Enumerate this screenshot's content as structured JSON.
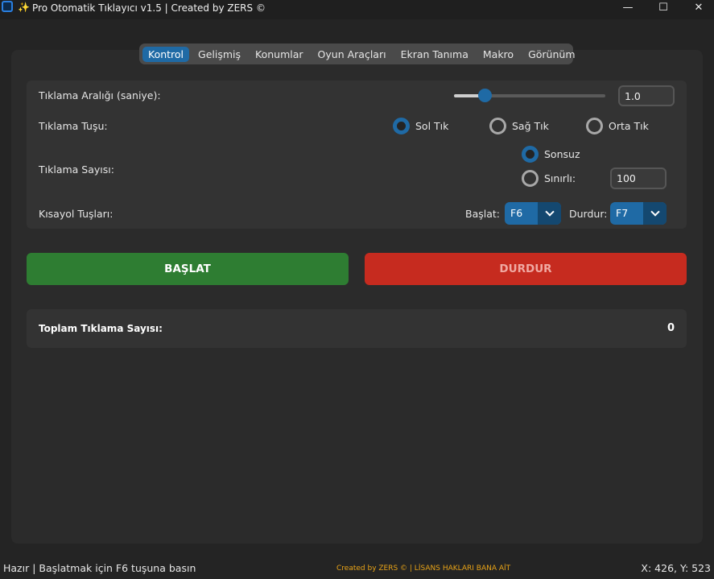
{
  "window": {
    "title": "Pro Otomatik Tıklayıcı v1.5 | Created by ZERS ©",
    "sparkle_glyph": "✨",
    "minimize_glyph": "—",
    "maximize_glyph": "☐",
    "close_glyph": "✕"
  },
  "tabs": [
    {
      "label": "Kontrol",
      "active": true
    },
    {
      "label": "Gelişmiş",
      "active": false
    },
    {
      "label": "Konumlar",
      "active": false
    },
    {
      "label": "Oyun Araçları",
      "active": false
    },
    {
      "label": "Ekran Tanıma",
      "active": false
    },
    {
      "label": "Makro",
      "active": false
    },
    {
      "label": "Görünüm",
      "active": false
    }
  ],
  "interval": {
    "label": "Tıklama Aralığı (saniye):",
    "slider_level": 0.2,
    "value": "1.0"
  },
  "button_type": {
    "label": "Tıklama Tuşu:",
    "options": [
      {
        "label": "Sol Tık",
        "selected": true
      },
      {
        "label": "Sağ Tık",
        "selected": false
      },
      {
        "label": "Orta Tık",
        "selected": false
      }
    ]
  },
  "click_count": {
    "label": "Tıklama Sayısı:",
    "infinite_label": "Sonsuz",
    "limited_label": "Sınırlı:",
    "limit_value": "100",
    "selected": "infinite"
  },
  "hotkeys": {
    "label": "Kısayol Tuşları:",
    "start_label": "Başlat:",
    "start_value": "F6",
    "stop_label": "Durdur:",
    "stop_value": "F7"
  },
  "actions": {
    "start_label": "BAŞLAT",
    "stop_label": "DURDUR"
  },
  "stats": {
    "label": "Toplam Tıklama Sayısı:",
    "value": "0"
  },
  "status": {
    "left": "Hazır | Başlatmak için F6 tuşuna basın",
    "center": "Created by ZERS © | LİSANS HAKLARI BANA AİT",
    "right": "X: 426, Y: 523"
  },
  "colors": {
    "accent": "#1f6aa5",
    "start": "#2e7d32",
    "stop": "#c62b1f",
    "credit": "#e8a317"
  }
}
